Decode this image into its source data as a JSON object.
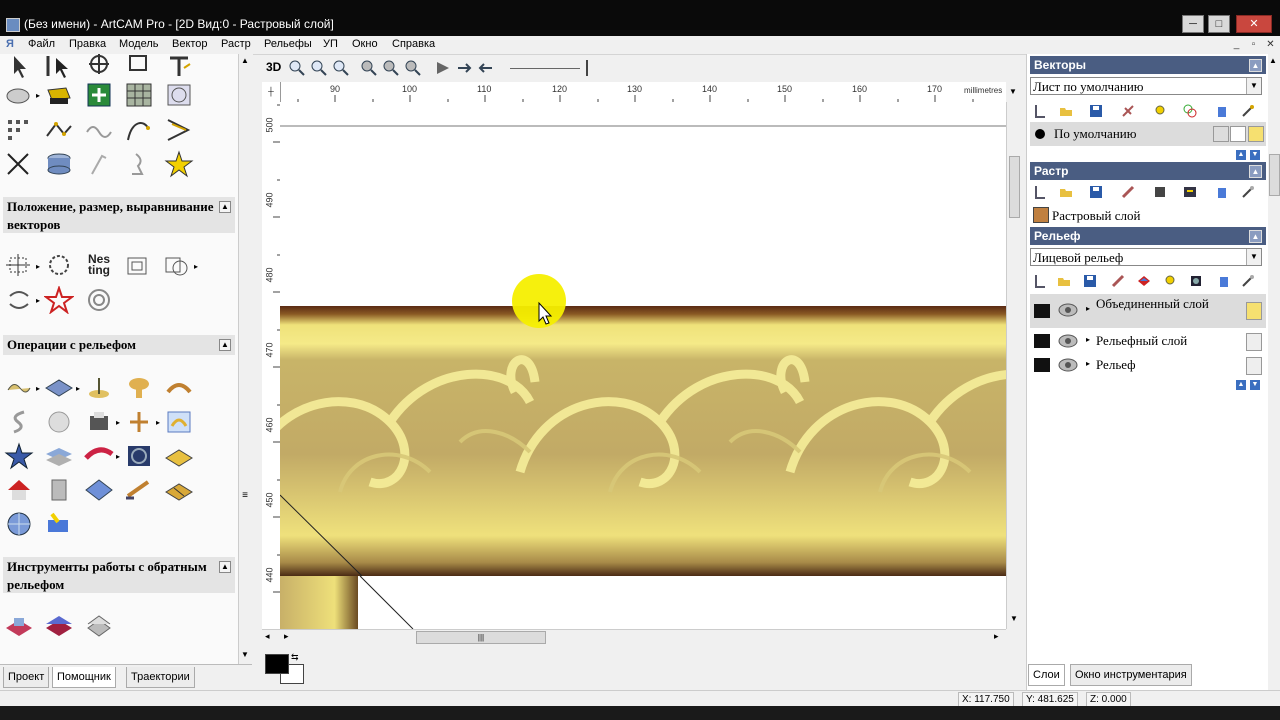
{
  "window": {
    "title": "(Без имени) - ArtCAM Pro - [2D Вид:0 - Растровый слой]",
    "minimize": "─",
    "maximize": "□",
    "close": "✕"
  },
  "menu": [
    "Файл",
    "Правка",
    "Модель",
    "Вектор",
    "Растр",
    "Рельефы",
    "УП",
    "Окно",
    "Справка"
  ],
  "left_panel": {
    "section_vectors_title": "Положение, размер, выравнивание векторов",
    "section_relief_ops_title": "Операции с рельефом",
    "section_reverse_title": "Инструменты работы с обратным рельефом",
    "nesting_label_1": "Nes",
    "nesting_label_2": "ting",
    "tabs": [
      "Проект",
      "Помощник",
      "Траектории"
    ]
  },
  "view": {
    "toolbar_3d": "3D",
    "ruler_units": "millimetres",
    "hruler_ticks": [
      "90",
      "100",
      "110",
      "120",
      "130",
      "140",
      "150",
      "160",
      "170"
    ],
    "vruler_ticks": [
      "500",
      "490",
      "480",
      "470",
      "460",
      "450",
      "440"
    ]
  },
  "status": {
    "x": "X: 117.750",
    "y": "Y: 481.625",
    "z": "Z: 0.000"
  },
  "right_panel": {
    "vectors_title": "Векторы",
    "vectors_sheet": "Лист по умолчанию",
    "vectors_layer": "По умолчанию",
    "raster_title": "Растр",
    "raster_layer": "Растровый слой",
    "relief_title": "Рельеф",
    "relief_selector": "Лицевой рельеф",
    "relief_layers": [
      "Объединенный слой",
      "Рельефный слой",
      "Рельеф"
    ],
    "tabs": [
      "Слои",
      "Окно инструментария"
    ]
  }
}
